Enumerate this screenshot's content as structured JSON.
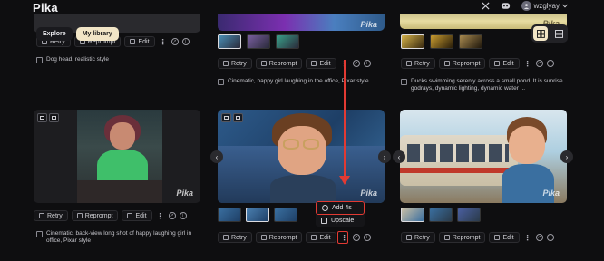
{
  "app": {
    "logo": "Pika"
  },
  "header": {
    "username": "wzglyay"
  },
  "nav": {
    "explore_label": "Explore",
    "library_label": "My library"
  },
  "action_labels": {
    "retry": "Retry",
    "reprompt": "Reprompt",
    "edit": "Edit"
  },
  "menu": {
    "add_label": "Add 4s",
    "upscale_label": "Upscale"
  },
  "watermark": "Pika",
  "cards": [
    {
      "caption": "Dog head, realistic style"
    },
    {
      "caption": "Cinematic, happy girl laughing in the office, Pixar style"
    },
    {
      "caption": "Ducks swimming serenly across a small pond. It is sunrise. godrays, dynamic lighting, dynamic water ..."
    },
    {
      "caption": "Cinematic, back-view long shot of happy laughing girl in office, Pixar style"
    },
    {
      "caption": ""
    },
    {
      "caption": ""
    }
  ],
  "colors": {
    "accent": "#f1e5c6",
    "highlight": "#e23a33",
    "background": "#0e0e10"
  }
}
